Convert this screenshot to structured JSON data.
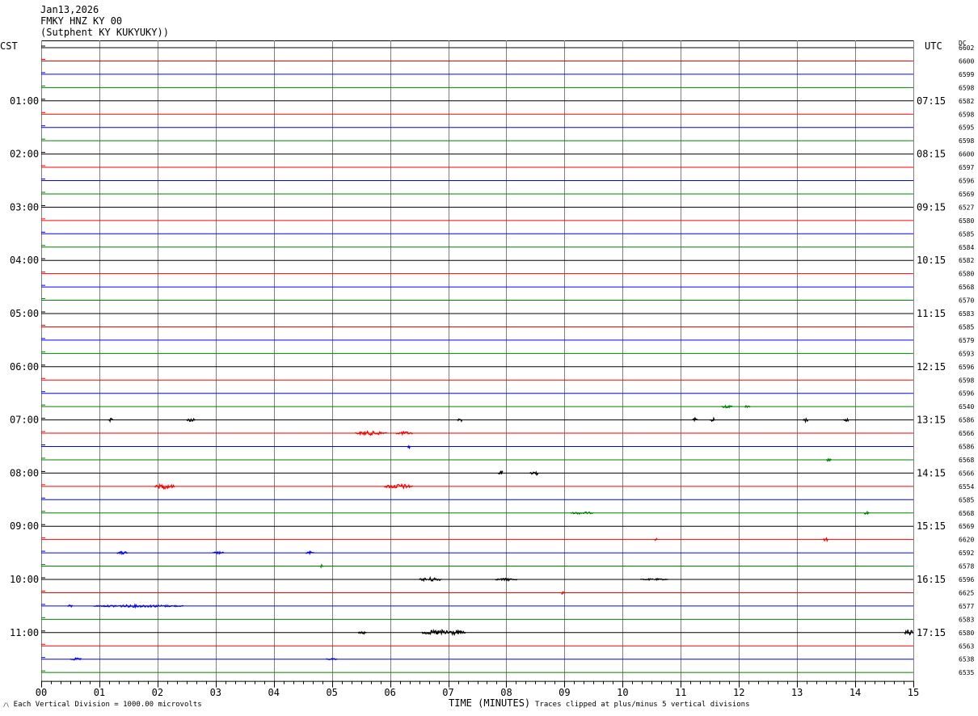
{
  "header": {
    "date": "Jan13,2026",
    "station": "FMKY HNZ KY 00",
    "location": "(Sutphent KY KUKYUKY))"
  },
  "labels": {
    "left_tz": "CST",
    "right_tz": "UTC",
    "dc": "DC",
    "x_title": "TIME (MINUTES)",
    "scale_note": "Each Vertical Division = 1000.00 microvolts",
    "clip_note": "Traces clipped at plus/minus 5 vertical divisions"
  },
  "colors": {
    "trace_cycle": [
      "#000000",
      "#ff0000",
      "#0000ff",
      "#008000"
    ],
    "grid": "#808080"
  },
  "chart_data": {
    "type": "line",
    "title": "",
    "xlabel": "TIME (MINUTES)",
    "xlim": [
      0,
      15
    ],
    "x_ticks": [
      "00",
      "01",
      "02",
      "03",
      "04",
      "05",
      "06",
      "07",
      "08",
      "09",
      "10",
      "11",
      "12",
      "13",
      "14",
      "15"
    ],
    "trace_count": 48,
    "left_time_labels": [
      {
        "row": 4,
        "label": "01:00"
      },
      {
        "row": 8,
        "label": "02:00"
      },
      {
        "row": 12,
        "label": "03:00"
      },
      {
        "row": 16,
        "label": "04:00"
      },
      {
        "row": 20,
        "label": "05:00"
      },
      {
        "row": 24,
        "label": "06:00"
      },
      {
        "row": 28,
        "label": "07:00"
      },
      {
        "row": 32,
        "label": "08:00"
      },
      {
        "row": 36,
        "label": "09:00"
      },
      {
        "row": 40,
        "label": "10:00"
      },
      {
        "row": 44,
        "label": "11:00"
      }
    ],
    "right_time_labels": [
      {
        "row": 4,
        "label": "07:15"
      },
      {
        "row": 8,
        "label": "08:15"
      },
      {
        "row": 12,
        "label": "09:15"
      },
      {
        "row": 16,
        "label": "10:15"
      },
      {
        "row": 20,
        "label": "11:15"
      },
      {
        "row": 24,
        "label": "12:15"
      },
      {
        "row": 28,
        "label": "13:15"
      },
      {
        "row": 32,
        "label": "14:15"
      },
      {
        "row": 36,
        "label": "15:15"
      },
      {
        "row": 40,
        "label": "16:15"
      },
      {
        "row": 44,
        "label": "17:15"
      }
    ],
    "dc_offsets": [
      "6602",
      "6600",
      "6599",
      "6598",
      "6582",
      "6598",
      "6595",
      "6598",
      "6600",
      "6597",
      "6596",
      "6569",
      "6527",
      "6580",
      "6585",
      "6584",
      "6582",
      "6580",
      "6568",
      "6570",
      "6583",
      "6585",
      "6579",
      "6593",
      "6596",
      "6598",
      "6596",
      "6540",
      "6586",
      "6566",
      "6586",
      "6568",
      "6566",
      "6554",
      "6585",
      "6568",
      "6569",
      "6620",
      "6592",
      "6578",
      "6596",
      "6625",
      "6577",
      "6583",
      "6580",
      "6563",
      "6538",
      "6535"
    ],
    "events": [
      {
        "row": 27,
        "start": 11.7,
        "end": 11.9,
        "amp": 2
      },
      {
        "row": 27,
        "start": 12.1,
        "end": 12.2,
        "amp": 2
      },
      {
        "row": 28,
        "start": 1.15,
        "end": 1.25,
        "amp": 3
      },
      {
        "row": 28,
        "start": 2.5,
        "end": 2.65,
        "amp": 2.5
      },
      {
        "row": 28,
        "start": 7.15,
        "end": 7.25,
        "amp": 2.5
      },
      {
        "row": 28,
        "start": 11.2,
        "end": 11.3,
        "amp": 2.5
      },
      {
        "row": 28,
        "start": 11.5,
        "end": 11.6,
        "amp": 2.5
      },
      {
        "row": 28,
        "start": 13.1,
        "end": 13.2,
        "amp": 2.5
      },
      {
        "row": 28,
        "start": 13.8,
        "end": 13.9,
        "amp": 3
      },
      {
        "row": 29,
        "start": 5.4,
        "end": 5.95,
        "amp": 2.5
      },
      {
        "row": 29,
        "start": 6.1,
        "end": 6.4,
        "amp": 2
      },
      {
        "row": 30,
        "start": 6.3,
        "end": 6.35,
        "amp": 2
      },
      {
        "row": 31,
        "start": 13.5,
        "end": 13.6,
        "amp": 2
      },
      {
        "row": 32,
        "start": 7.85,
        "end": 7.95,
        "amp": 3
      },
      {
        "row": 32,
        "start": 8.4,
        "end": 8.55,
        "amp": 4
      },
      {
        "row": 33,
        "start": 1.95,
        "end": 2.3,
        "amp": 3
      },
      {
        "row": 33,
        "start": 5.9,
        "end": 6.4,
        "amp": 3
      },
      {
        "row": 35,
        "start": 9.1,
        "end": 9.5,
        "amp": 1.5
      },
      {
        "row": 35,
        "start": 14.15,
        "end": 14.25,
        "amp": 2
      },
      {
        "row": 37,
        "start": 10.55,
        "end": 10.6,
        "amp": 1.5
      },
      {
        "row": 37,
        "start": 13.45,
        "end": 13.55,
        "amp": 2
      },
      {
        "row": 38,
        "start": 1.3,
        "end": 1.5,
        "amp": 2
      },
      {
        "row": 38,
        "start": 2.95,
        "end": 3.15,
        "amp": 1.5
      },
      {
        "row": 38,
        "start": 4.55,
        "end": 4.7,
        "amp": 2
      },
      {
        "row": 39,
        "start": 4.8,
        "end": 4.85,
        "amp": 2
      },
      {
        "row": 40,
        "start": 6.5,
        "end": 6.9,
        "amp": 2.5
      },
      {
        "row": 40,
        "start": 7.8,
        "end": 8.2,
        "amp": 1.5
      },
      {
        "row": 40,
        "start": 10.3,
        "end": 10.8,
        "amp": 1
      },
      {
        "row": 41,
        "start": 8.95,
        "end": 9.0,
        "amp": 2.5
      },
      {
        "row": 42,
        "start": 0.45,
        "end": 0.55,
        "amp": 1.5
      },
      {
        "row": 42,
        "start": 0.9,
        "end": 2.45,
        "amp": 1.5
      },
      {
        "row": 44,
        "start": 5.45,
        "end": 5.6,
        "amp": 2
      },
      {
        "row": 44,
        "start": 6.55,
        "end": 7.3,
        "amp": 3.5
      },
      {
        "row": 44,
        "start": 14.85,
        "end": 15.0,
        "amp": 4
      },
      {
        "row": 46,
        "start": 0.5,
        "end": 0.7,
        "amp": 1.5
      },
      {
        "row": 46,
        "start": 4.9,
        "end": 5.1,
        "amp": 1
      }
    ]
  }
}
